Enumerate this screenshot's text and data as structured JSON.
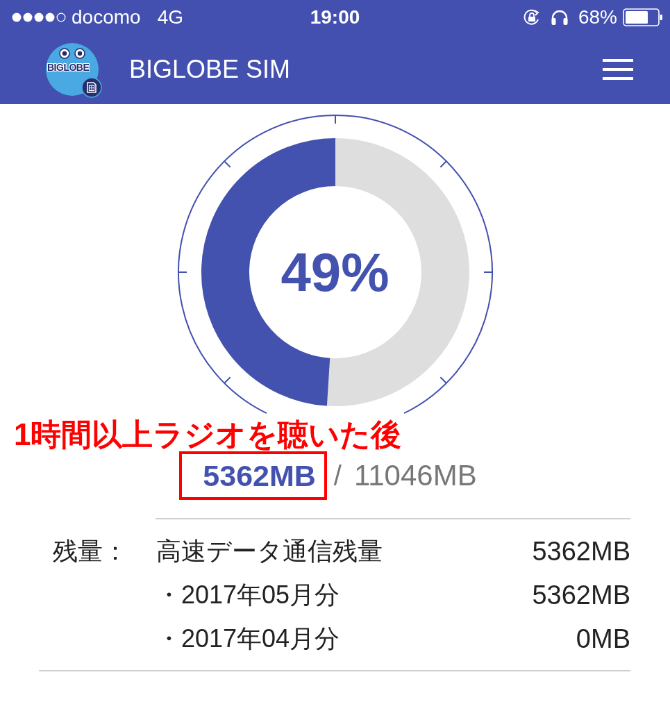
{
  "status_bar": {
    "carrier": "docomo",
    "network": "4G",
    "time": "19:00",
    "battery_percent": "68%"
  },
  "header": {
    "logo_text": "BIGLOBE",
    "title": "BIGLOBE SIM"
  },
  "gauge": {
    "level": 0.49,
    "percent": "49%"
  },
  "annotation": {
    "text": "1時間以上ラジオを聴いた後"
  },
  "usage": {
    "used": "5362MB",
    "highlighted": true,
    "separator": "/",
    "total": "11046MB"
  },
  "remaining": {
    "label": "残量：",
    "rows": [
      {
        "name": "高速データ通信残量",
        "value": "5362MB"
      },
      {
        "name": "・2017年05月分",
        "value": "5362MB"
      },
      {
        "name": "・2017年04月分",
        "value": "0MB"
      }
    ]
  }
}
